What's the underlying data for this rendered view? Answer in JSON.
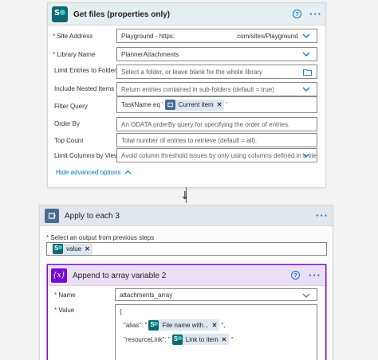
{
  "get_files": {
    "title": "Get files (properties only)",
    "help": "?",
    "more": "···",
    "fields": [
      {
        "label": "Site Address",
        "required": true,
        "value": "Playground - https:",
        "value2": "com/sites/Playground"
      },
      {
        "label": "Library Name",
        "required": true,
        "value": "PlannerAttachments"
      },
      {
        "label": "Limit Entries to Folder",
        "placeholder": "Select a folder, or leave blank for the whole library"
      },
      {
        "label": "Include Nested Items",
        "placeholder": "Return entries contained in sub-folders (default = true)"
      },
      {
        "label": "Filter Query",
        "prefix": "TaskName eq '",
        "token": "Current item",
        "suffix": "'"
      },
      {
        "label": "Order By",
        "placeholder": "An ODATA orderBy query for specifying the order of entries."
      },
      {
        "label": "Top Count",
        "placeholder": "Total number of entries to retrieve (default = all)."
      },
      {
        "label": "Limit Columns by View",
        "placeholder": "Avoid column threshold issues by only using columns defined in a view"
      }
    ],
    "hide_advanced": "Hide advanced options"
  },
  "arrow": "↓",
  "apply_each": {
    "title": "Apply to each 3",
    "more": "···",
    "select_label": "Select an output from previous steps",
    "token": "value"
  },
  "append": {
    "title": "Append to array variable 2",
    "icon_text": "{x}",
    "help": "?",
    "more": "···",
    "name_label": "Name",
    "name_value": "attachments_array",
    "value_label": "Value",
    "value_lines": {
      "open": "{",
      "alias_key": "\"alias\": \"",
      "alias_token": "File name with...",
      "alias_end": "\",",
      "res_key": "\"resourceLink\": \"",
      "res_token": "Link to item",
      "res_end": "\""
    }
  },
  "colors": {
    "accent": "#0078d4",
    "sharepoint": "#0c6a6f",
    "loop": "#486991",
    "variable": "#770bd6"
  }
}
